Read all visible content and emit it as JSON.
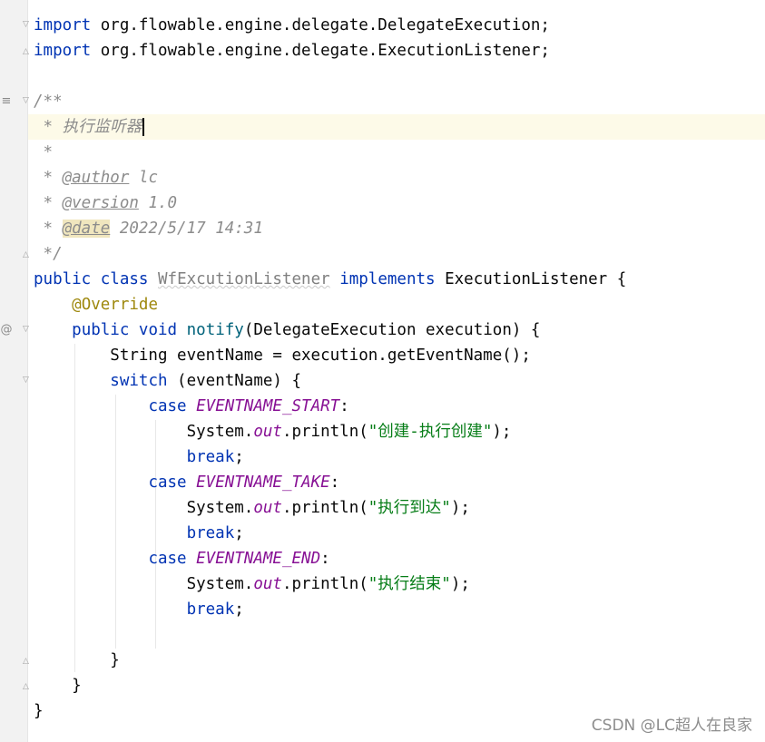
{
  "lines": [
    {
      "t": [
        "import",
        " org.flowable.engine.delegate.DelegateExecution;"
      ]
    },
    {
      "t": [
        "import",
        " org.flowable.engine.delegate.ExecutionListener;"
      ]
    },
    {
      "t": []
    },
    {
      "t": [
        "/**"
      ]
    },
    {
      "t": [
        " * 执行监听器"
      ]
    },
    {
      "t": [
        " *"
      ]
    },
    {
      "t": [
        " * ",
        "@author",
        " lc"
      ]
    },
    {
      "t": [
        " * ",
        "@version",
        " 1.0"
      ]
    },
    {
      "t": [
        " * ",
        "@date",
        " 2022/5/17 14:31"
      ]
    },
    {
      "t": [
        " */"
      ]
    },
    {
      "t": [
        "public",
        " ",
        "class",
        " ",
        "WfExcutionListener",
        " ",
        "implements",
        " ExecutionListener {"
      ]
    },
    {
      "t": [
        "    ",
        "@Override"
      ]
    },
    {
      "t": [
        "    ",
        "public",
        " ",
        "void",
        " ",
        "notify",
        "(DelegateExecution execution) {"
      ]
    },
    {
      "t": [
        "        String eventName = execution.getEventName();"
      ]
    },
    {
      "t": [
        "        ",
        "switch",
        " (eventName) {"
      ]
    },
    {
      "t": [
        "            ",
        "case",
        " ",
        "EVENTNAME_START",
        ":"
      ]
    },
    {
      "t": [
        "                System.",
        "out",
        ".println(",
        "\"创建-执行创建\"",
        ");"
      ]
    },
    {
      "t": [
        "                ",
        "break",
        ";"
      ]
    },
    {
      "t": [
        "            ",
        "case",
        " ",
        "EVENTNAME_TAKE",
        ":"
      ]
    },
    {
      "t": [
        "                System.",
        "out",
        ".println(",
        "\"执行到达\"",
        ");"
      ]
    },
    {
      "t": [
        "                ",
        "break",
        ";"
      ]
    },
    {
      "t": [
        "            ",
        "case",
        " ",
        "EVENTNAME_END",
        ":"
      ]
    },
    {
      "t": [
        "                System.",
        "out",
        ".println(",
        "\"执行结束\"",
        ");"
      ]
    },
    {
      "t": [
        "                ",
        "break",
        ";"
      ]
    },
    {
      "t": []
    },
    {
      "t": [
        "        }"
      ]
    },
    {
      "t": [
        "    }"
      ]
    },
    {
      "t": [
        "}"
      ]
    }
  ],
  "gutter": {
    "doc_mark": "≡",
    "override_mark": "@"
  },
  "watermark": "CSDN @LC超人在良家",
  "colors": {
    "keyword": "#0033b3",
    "comment": "#8c8c8c",
    "annotation": "#9e880d",
    "method": "#00627a",
    "constant": "#871094",
    "string": "#067d17",
    "current_line": "#fdfae8"
  }
}
